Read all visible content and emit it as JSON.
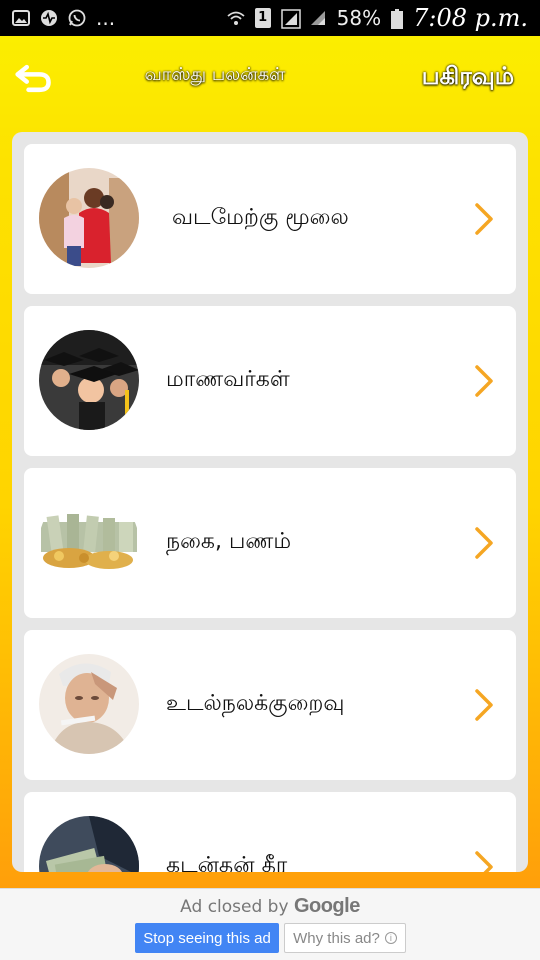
{
  "status_bar": {
    "overflow": "...",
    "sim": "1",
    "battery": "58%",
    "time": "7:08 p.m."
  },
  "toolbar": {
    "title": "வாஸ்து பலன்கள்",
    "share_label": "பகிரவும்"
  },
  "list": {
    "items": [
      {
        "label": "வடமேற்கு மூலை",
        "icon": "family-photo"
      },
      {
        "label": "மாணவர்கள்",
        "icon": "graduates-photo"
      },
      {
        "label": "நகை, பணம்",
        "icon": "money-gold-photo"
      },
      {
        "label": "உடல்நலக்குறைவு",
        "icon": "sick-man-photo"
      },
      {
        "label": "கடன்தன் தீர",
        "icon": "money-hand-photo"
      }
    ]
  },
  "ad": {
    "closed_by": "Ad closed by",
    "brand": "Google",
    "stop_label": "Stop seeing this ad",
    "why_label": "Why this ad?",
    "info_glyph": "i"
  },
  "colors": {
    "header_yellow": "#fbee00",
    "bottom_orange": "#ff9f0a",
    "chevron": "#f5a623",
    "ad_blue": "#4285f4"
  }
}
